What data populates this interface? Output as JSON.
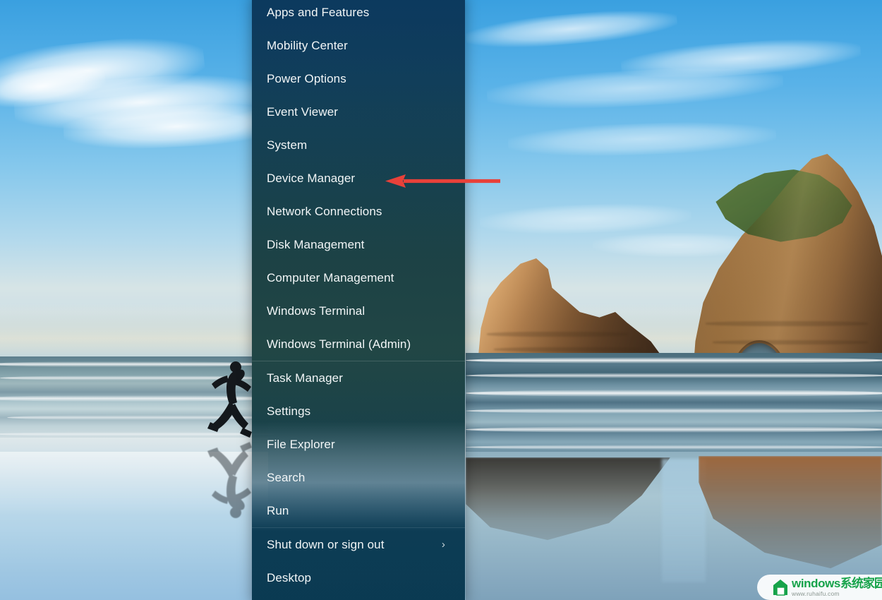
{
  "wallpaper": {
    "name": "windows-11-bloom-beach-wallpaper",
    "description": "Coastal beach at sunset with rock stacks and a running person silhouette"
  },
  "context_menu": {
    "name": "win-x-power-user-menu",
    "sections": [
      {
        "id": "tools",
        "items": [
          {
            "label": "Apps and Features",
            "submenu": false
          },
          {
            "label": "Mobility Center",
            "submenu": false
          },
          {
            "label": "Power Options",
            "submenu": false
          },
          {
            "label": "Event Viewer",
            "submenu": false
          },
          {
            "label": "System",
            "submenu": false
          },
          {
            "label": "Device Manager",
            "submenu": false
          },
          {
            "label": "Network Connections",
            "submenu": false
          },
          {
            "label": "Disk Management",
            "submenu": false
          },
          {
            "label": "Computer Management",
            "submenu": false
          },
          {
            "label": "Windows Terminal",
            "submenu": false
          },
          {
            "label": "Windows Terminal (Admin)",
            "submenu": false
          }
        ]
      },
      {
        "id": "shell",
        "items": [
          {
            "label": "Task Manager",
            "submenu": false
          },
          {
            "label": "Settings",
            "submenu": false
          },
          {
            "label": "File Explorer",
            "submenu": false
          },
          {
            "label": "Search",
            "submenu": false
          },
          {
            "label": "Run",
            "submenu": false
          }
        ]
      },
      {
        "id": "session",
        "items": [
          {
            "label": "Shut down or sign out",
            "submenu": true,
            "submenu_glyph": "›"
          },
          {
            "label": "Desktop",
            "submenu": false
          }
        ]
      }
    ]
  },
  "annotation": {
    "type": "arrow",
    "color": "#e8413a",
    "direction": "left",
    "points_to": "Device Manager"
  },
  "watermark": {
    "brand": "windows",
    "brand_cn": "系统家园",
    "url": "www.ruhaifu.com",
    "color": "#16a34a"
  }
}
